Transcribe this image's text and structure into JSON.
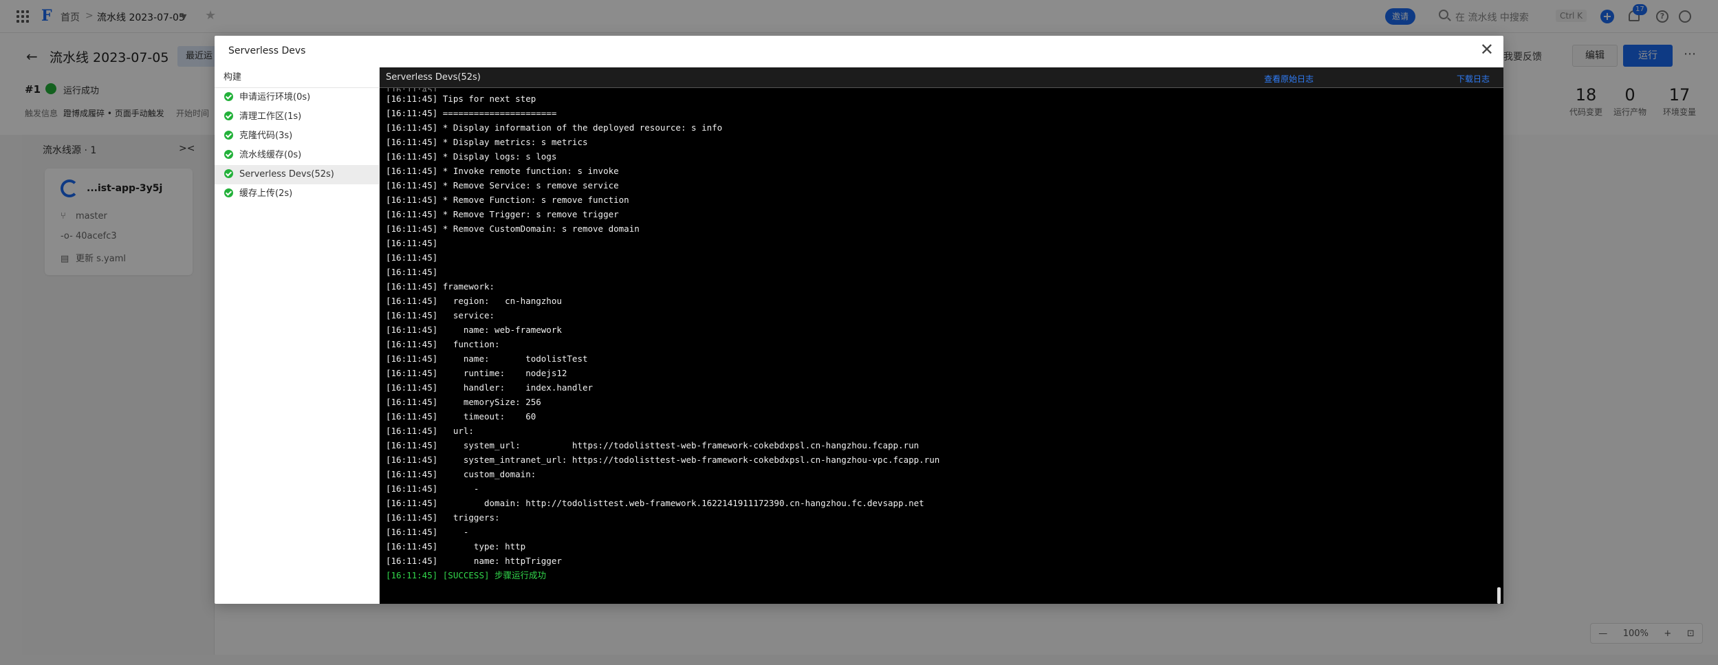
{
  "topbar": {
    "home": "首页",
    "sep": ">",
    "pipeline": "流水线 2023-07-05",
    "invite": "邀请",
    "search_placeholder": "在 流水线 中搜索",
    "shortcut": "Ctrl K",
    "notif_count": "17"
  },
  "header": {
    "title": "流水线 2023-07-05",
    "recent": "最近运行",
    "feedback": "我要反馈",
    "edit": "编辑",
    "run": "运行",
    "run_no": "#1",
    "run_status": "运行成功",
    "trigger_label": "触发信息",
    "trigger_value": "蹬博成履碎 • 页面手动触发",
    "start_label": "开始时间",
    "stats": [
      {
        "num": "18",
        "label": "代码变更"
      },
      {
        "num": "0",
        "label": "运行产物"
      },
      {
        "num": "17",
        "label": "环境变量"
      }
    ]
  },
  "source": {
    "title": "流水线源 · 1",
    "repo": "...ist-app-3y5j",
    "branch": "master",
    "commit": "40acefc3",
    "message": "更新 s.yaml"
  },
  "zoom": {
    "level": "100%"
  },
  "modal": {
    "title": "Serverless Devs",
    "steps_header": "构建",
    "steps": [
      {
        "label": "申请运行环境(0s)",
        "active": false
      },
      {
        "label": "清理工作区(1s)",
        "active": false
      },
      {
        "label": "克隆代码(3s)",
        "active": false
      },
      {
        "label": "流水线缓存(0s)",
        "active": false
      },
      {
        "label": "Serverless Devs(52s)",
        "active": true
      },
      {
        "label": "缓存上传(2s)",
        "active": false
      }
    ],
    "log_title": "Serverless Devs(52s)",
    "view_raw": "查看原始日志",
    "download": "下载日志",
    "log_lines": [
      "[16:11:45] Tips for next step",
      "[16:11:45] ======================",
      "[16:11:45] * Display information of the deployed resource: s info",
      "[16:11:45] * Display metrics: s metrics",
      "[16:11:45] * Display logs: s logs",
      "[16:11:45] * Invoke remote function: s invoke",
      "[16:11:45] * Remove Service: s remove service",
      "[16:11:45] * Remove Function: s remove function",
      "[16:11:45] * Remove Trigger: s remove trigger",
      "[16:11:45] * Remove CustomDomain: s remove domain",
      "[16:11:45]",
      "[16:11:45]",
      "[16:11:45]",
      "[16:11:45] framework:",
      "[16:11:45]   region:   cn-hangzhou",
      "[16:11:45]   service:",
      "[16:11:45]     name: web-framework",
      "[16:11:45]   function:",
      "[16:11:45]     name:       todolistTest",
      "[16:11:45]     runtime:    nodejs12",
      "[16:11:45]     handler:    index.handler",
      "[16:11:45]     memorySize: 256",
      "[16:11:45]     timeout:    60",
      "[16:11:45]   url:",
      "[16:11:45]     system_url:          https://todolisttest-web-framework-cokebdxpsl.cn-hangzhou.fcapp.run",
      "[16:11:45]     system_intranet_url: https://todolisttest-web-framework-cokebdxpsl.cn-hangzhou-vpc.fcapp.run",
      "[16:11:45]     custom_domain:",
      "[16:11:45]       -",
      "[16:11:45]         domain: http://todolisttest.web-framework.1622141911172390.cn-hangzhou.fc.devsapp.net",
      "[16:11:45]   triggers:",
      "[16:11:45]     -",
      "[16:11:45]       type: http",
      "[16:11:45]       name: httpTrigger"
    ],
    "success_line": "[16:11:45] [SUCCESS] 步骤运行成功"
  },
  "colors": {
    "accent": "#1b6af0",
    "success": "#23b13a",
    "log_success": "#32d74b",
    "log_bg": "#000000"
  }
}
